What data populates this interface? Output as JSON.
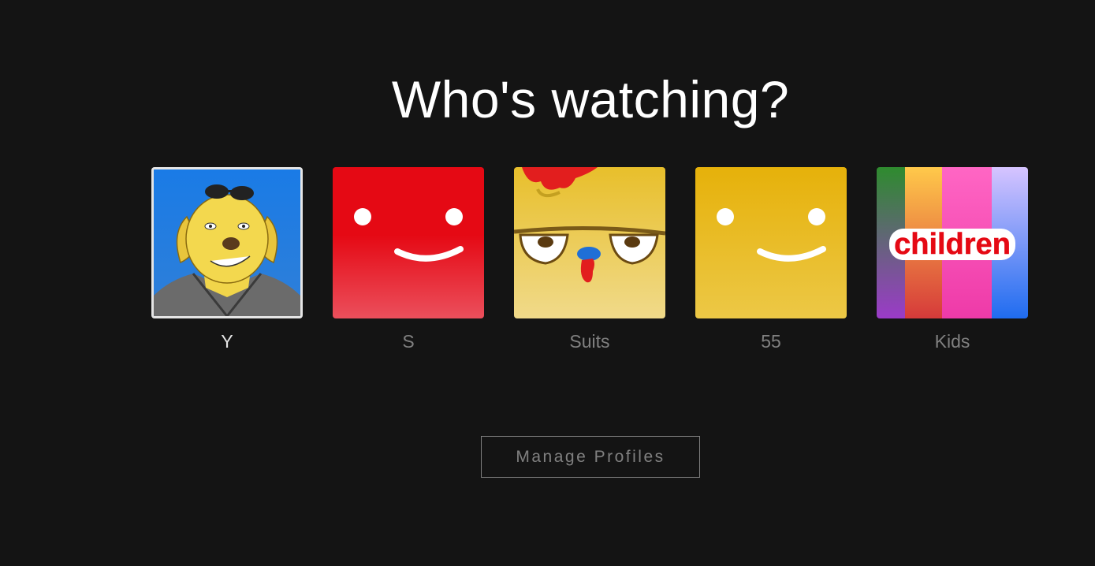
{
  "header": {
    "title": "Who's watching?"
  },
  "profiles": [
    {
      "name": "Y",
      "avatar": "dog-with-sunglasses-avatar",
      "selected": true
    },
    {
      "name": "S",
      "avatar": "red-smiley-avatar",
      "color": "#e50914",
      "selected": false
    },
    {
      "name": "Suits",
      "avatar": "yellow-chicken-avatar",
      "selected": false
    },
    {
      "name": "55",
      "avatar": "yellow-smiley-avatar",
      "color": "#e6b312",
      "selected": false
    },
    {
      "name": "Kids",
      "avatar": "children-avatar",
      "logo_text": "children",
      "selected": false
    }
  ],
  "actions": {
    "manage_label": "Manage Profiles"
  },
  "colors": {
    "background": "#141414",
    "title": "#ffffff",
    "muted": "#808080",
    "selected_border": "#e5e5e5"
  }
}
